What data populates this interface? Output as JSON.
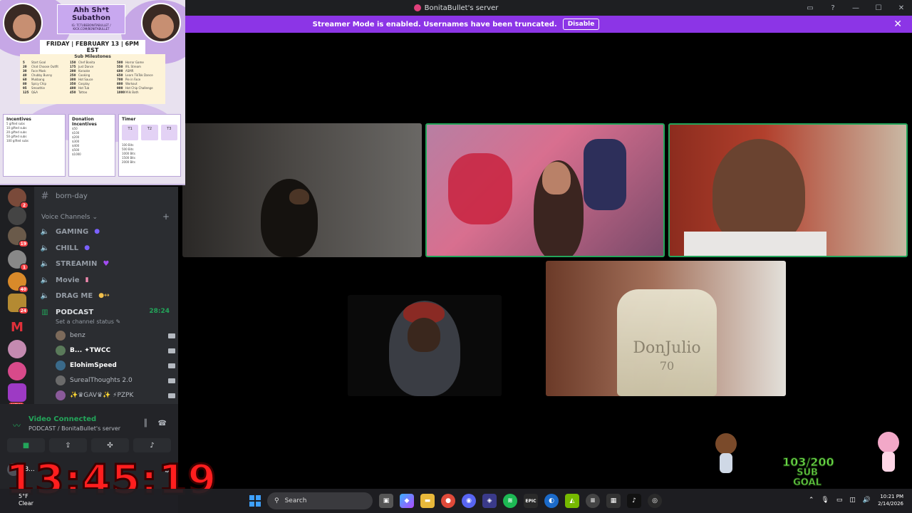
{
  "window": {
    "title": "BonitaBullet's server"
  },
  "banner": {
    "message": "Streamer Mode is enabled. Usernames have been truncated.",
    "disable_label": "Disable"
  },
  "poster": {
    "title": "Ahh Sh*t Subathon",
    "socials": "IG: TCTUBEBONITABULLET / KICK.COM/BONITABULLET",
    "date": "FRIDAY | FEBRUARY 13 | 6PM EST",
    "milestones_title": "Sub Milestones",
    "milestones_col1": [
      {
        "n": "5",
        "t": "Start Goal"
      },
      {
        "n": "20",
        "t": "Chat Choose Outfit"
      },
      {
        "n": "30",
        "t": "Face Mask"
      },
      {
        "n": "40",
        "t": "Chubby Bunny"
      },
      {
        "n": "60",
        "t": "Mukbang"
      },
      {
        "n": "80",
        "t": "Spicy Chip"
      },
      {
        "n": "95",
        "t": "Smoothie"
      },
      {
        "n": "125",
        "t": "Q&A"
      }
    ],
    "milestones_col2": [
      {
        "n": "150",
        "t": "Chef Bonita"
      },
      {
        "n": "175",
        "t": "Just Dance"
      },
      {
        "n": "200",
        "t": "Karaoke"
      },
      {
        "n": "250",
        "t": "Cooking"
      },
      {
        "n": "300",
        "t": "Hot Sauce"
      },
      {
        "n": "350",
        "t": "Cosplay"
      },
      {
        "n": "400",
        "t": "Hot Tub"
      },
      {
        "n": "450",
        "t": "Tattoo"
      }
    ],
    "milestones_col3": [
      {
        "n": "500",
        "t": "Horror Game"
      },
      {
        "n": "550",
        "t": "IRL Stream"
      },
      {
        "n": "600",
        "t": "ASMR"
      },
      {
        "n": "650",
        "t": "Learn TikTok Dance"
      },
      {
        "n": "700",
        "t": "Pie in Face"
      },
      {
        "n": "800",
        "t": "Workout"
      },
      {
        "n": "900",
        "t": "Hot Chip Challenge"
      },
      {
        "n": "1000",
        "t": "Milk Bath"
      }
    ],
    "incentives_title": "Incentives",
    "incentives": [
      "5 gifted subs",
      "10 gifted subs",
      "20 gifted subs",
      "50 gifted subs",
      "100 gifted subs"
    ],
    "donation_title": "Donation Incentives",
    "donations": [
      "$50",
      "$100",
      "$200",
      "$300",
      "$400",
      "$500",
      "$1000"
    ],
    "timer_title": "Timer",
    "timer_tiers": [
      "T1",
      "T2",
      "T3"
    ],
    "timer_bits": [
      "100 Bits",
      "500 Bits",
      "1000 Bits",
      "1500 Bits",
      "2000 Bits"
    ]
  },
  "channels": {
    "text_channel": "born-day",
    "section": "Voice Channels",
    "voice": [
      {
        "label": "GAMING"
      },
      {
        "label": "CHILL"
      },
      {
        "label": "STREAMIN"
      },
      {
        "label": "Movie"
      },
      {
        "label": "DRAG ME"
      }
    ],
    "active_voice": "PODCAST",
    "active_time": "28:24",
    "channel_status": "Set a channel status",
    "users": [
      {
        "name": "benz"
      },
      {
        "name": "B... ✦TWCC"
      },
      {
        "name": "ElohimSpeed"
      },
      {
        "name": "SurealThoughts 2.0"
      },
      {
        "name": "✨♛GAV♛✨ ⚡PZPK"
      }
    ]
  },
  "servers": {
    "badges": [
      "2",
      "19",
      "1",
      "40",
      "24",
      "NEW"
    ]
  },
  "voice_panel": {
    "status": "Video Connected",
    "location": "PODCAST / BonitaBullet's server",
    "user_short": "B..."
  },
  "overlay": {
    "big_timer": "13:45:19",
    "sub_count": "103/200",
    "sub_goal_label": "SUB GOAL"
  },
  "tiles": [
    {
      "speaking": false
    },
    {
      "speaking": true
    },
    {
      "speaking": true
    },
    {
      "speaking": false
    },
    {
      "speaking": false
    }
  ],
  "bottle_text": {
    "brand": "DonJulio",
    "year": "70"
  },
  "taskbar": {
    "weather_temp": "5°F",
    "weather_desc": "Clear",
    "search_placeholder": "Search",
    "time": "10:21 PM",
    "date": "2/14/2026"
  },
  "colors": {
    "accent_green": "#23a55a",
    "banner_purple": "#8c35e6",
    "timer_red": "#ff1e1e",
    "sub_goal_green": "#6fe04a"
  }
}
